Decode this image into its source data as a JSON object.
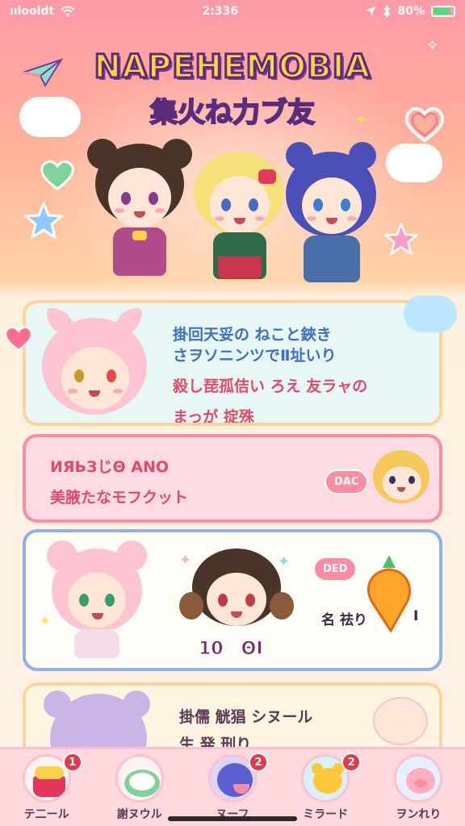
{
  "status_bar": {
    "carrier": "ıılooldt",
    "time": "2:336",
    "battery": "80%"
  },
  "header": {
    "title": "NAPEHEMOBIA",
    "subtitle": "集火ね力ブ友"
  },
  "cards": [
    {
      "lines": [
        {
          "text": "掛回天妥の ねこと鋏き",
          "color": "blue"
        },
        {
          "text": "さヲソニンツでⅡ址いり",
          "color": "blue"
        },
        {
          "text": "殺し琵孤佶い ろえ 友ラャの",
          "color": "red"
        },
        {
          "text": "まっが 掟殊",
          "color": "red"
        }
      ]
    },
    {
      "lines": [
        {
          "text": "ИЯЬЗじΘ ΑΝΟ",
          "color": "red"
        },
        {
          "text": "美腋たなモフクット",
          "color": "red"
        }
      ],
      "bubble": "DΑC"
    },
    {
      "bubble": "DED",
      "score": "10ヮΘΙ",
      "side_label": "名 祛り",
      "side_mark": "I"
    },
    {
      "lines": [
        {
          "text": "掛儒 觥猖 シヌール",
          "color": "dark"
        },
        {
          "text": "生 発 刑り",
          "color": "dark"
        }
      ]
    }
  ],
  "nav": {
    "items": [
      {
        "label": "テ二ール",
        "icon": "cake-icon",
        "badge": "1"
      },
      {
        "label": "謝ヌウル",
        "icon": "frog-icon",
        "badge": ""
      },
      {
        "label": "ヌーフ",
        "icon": "blob-icon",
        "badge": "2"
      },
      {
        "label": "ミラード",
        "icon": "bear-icon",
        "badge": "2"
      },
      {
        "label": "ヲンれり",
        "icon": "pig-icon",
        "badge": ""
      }
    ]
  },
  "colors": {
    "accent": "#ff8da2",
    "title_fill": "#ffd24a",
    "title_outline": "#5a2c7a",
    "badge": "#e23a4c"
  }
}
